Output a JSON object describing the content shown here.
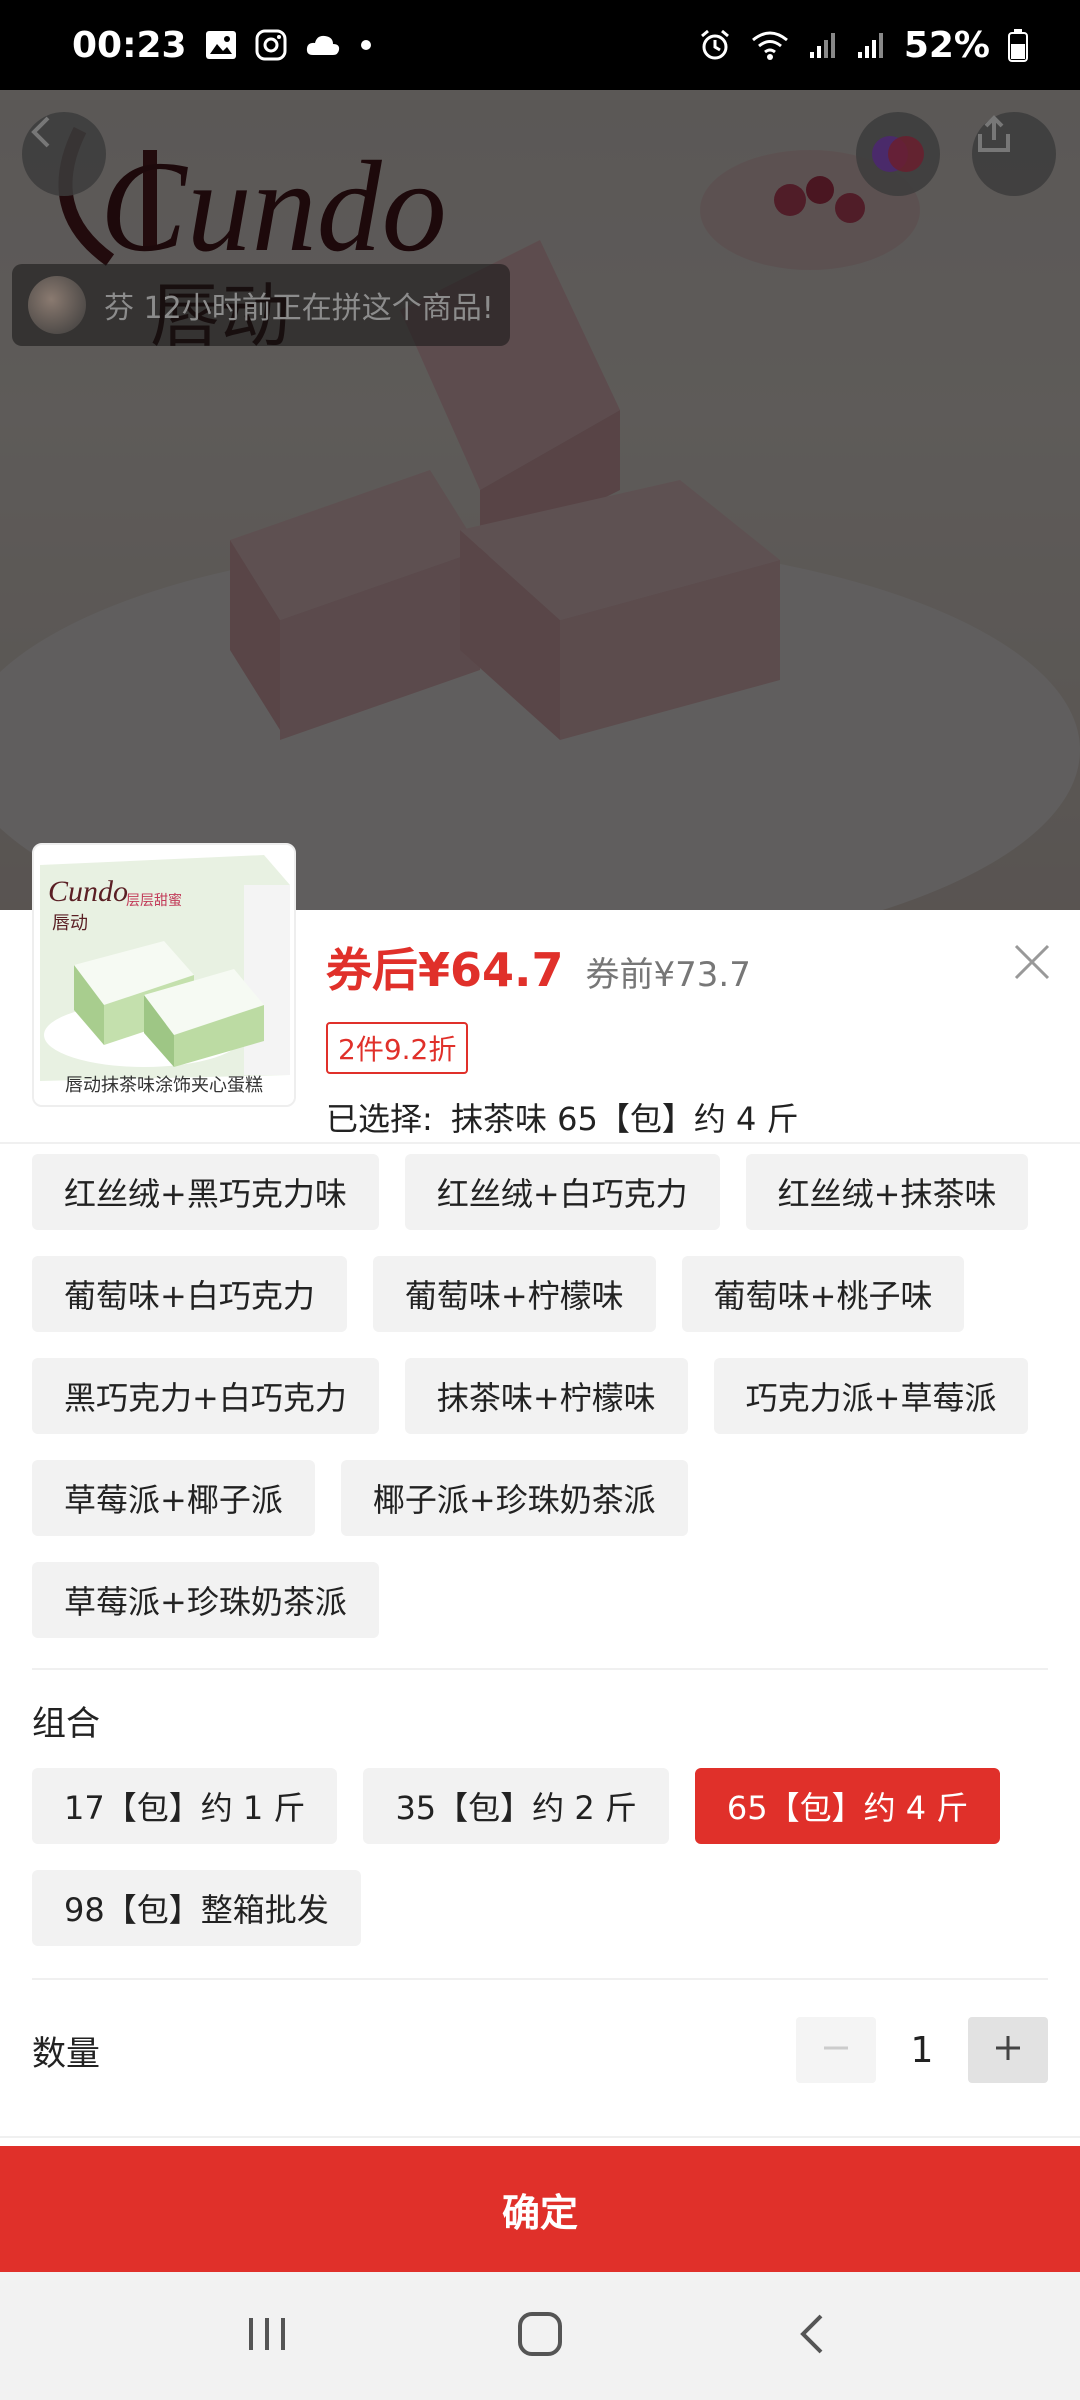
{
  "status_bar": {
    "time": "00:23",
    "battery": "52%",
    "icons": [
      "image-icon",
      "instagram-icon",
      "cloud-icon",
      "dot-icon",
      "alarm-icon",
      "wifi-icon",
      "signal-icon",
      "signal-icon",
      "battery-icon"
    ]
  },
  "hero": {
    "group_notice": "芬 12小时前正在拼这个商品!"
  },
  "product": {
    "thumb_caption": "唇动抹茶味涂饰夹心蛋糕",
    "price_after_coupon": "券后¥64.7",
    "price_before_coupon": "券前¥73.7",
    "promo": "2件9.2折",
    "selected_label": "已选择:",
    "selected_value": "抹茶味 65【包】约 4 斤"
  },
  "flavor_options": [
    {
      "label": "红丝绒+黑巧克力味"
    },
    {
      "label": "红丝绒+白巧克力"
    },
    {
      "label": "红丝绒+抹茶味"
    },
    {
      "label": "葡萄味+白巧克力"
    },
    {
      "label": "葡萄味+柠檬味"
    },
    {
      "label": "葡萄味+桃子味"
    },
    {
      "label": "黑巧克力+白巧克力"
    },
    {
      "label": "抹茶味+柠檬味"
    },
    {
      "label": "巧克力派+草莓派"
    },
    {
      "label": "草莓派+椰子派"
    },
    {
      "label": "椰子派+珍珠奶茶派"
    },
    {
      "label": "草莓派+珍珠奶茶派"
    }
  ],
  "combo": {
    "title": "组合",
    "options": [
      {
        "label": "17【包】约 1 斤",
        "selected": false
      },
      {
        "label": "35【包】约 2 斤",
        "selected": false
      },
      {
        "label": "65【包】约 4 斤",
        "selected": true
      },
      {
        "label": "98【包】整箱批发",
        "selected": false
      }
    ]
  },
  "quantity": {
    "label": "数量",
    "value": "1"
  },
  "confirm_label": "确定",
  "colors": {
    "accent": "#e0302a",
    "chip_bg": "#f2f2f2"
  }
}
